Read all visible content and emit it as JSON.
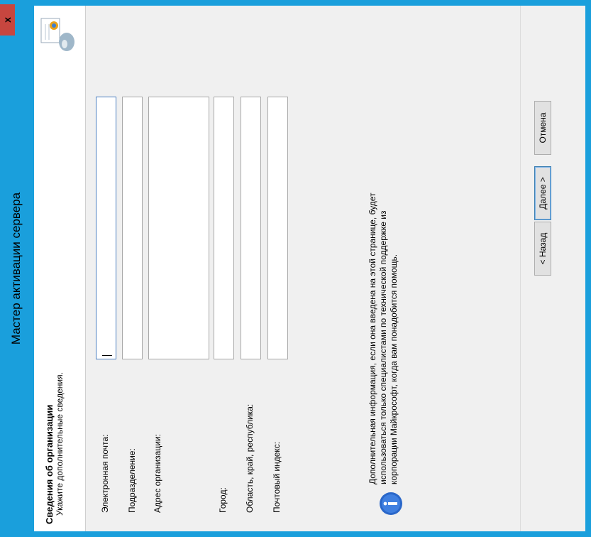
{
  "window": {
    "title": "Мастер активации сервера",
    "close_glyph": "x"
  },
  "header": {
    "title": "Сведения об организации",
    "subtitle": "Укажите дополнительные сведения.",
    "icon": "certificate-icon"
  },
  "form": {
    "email_label": "Электронная почта:",
    "department_label": "Подразделение:",
    "address_label": "Адрес организации:",
    "city_label": "Город:",
    "region_label": "Область, край, республика:",
    "postal_label": "Почтовый индекс:",
    "email_value": "",
    "department_value": "",
    "address_value": "",
    "city_value": "",
    "region_value": "",
    "postal_value": ""
  },
  "info": {
    "icon": "info-icon",
    "line1": "Дополнительная информация, если она введена на этой странице, будет",
    "line2": "использоваться только специалистами по технической поддержке из",
    "line3": "корпорации Майкрософт, когда вам понадобится помощь."
  },
  "buttons": {
    "back": "< Назад",
    "next": "Далее >",
    "cancel": "Отмена"
  },
  "colors": {
    "titlebar": "#1a9fdc",
    "close": "#c7463f",
    "dialog_bg": "#f0f0f0"
  }
}
